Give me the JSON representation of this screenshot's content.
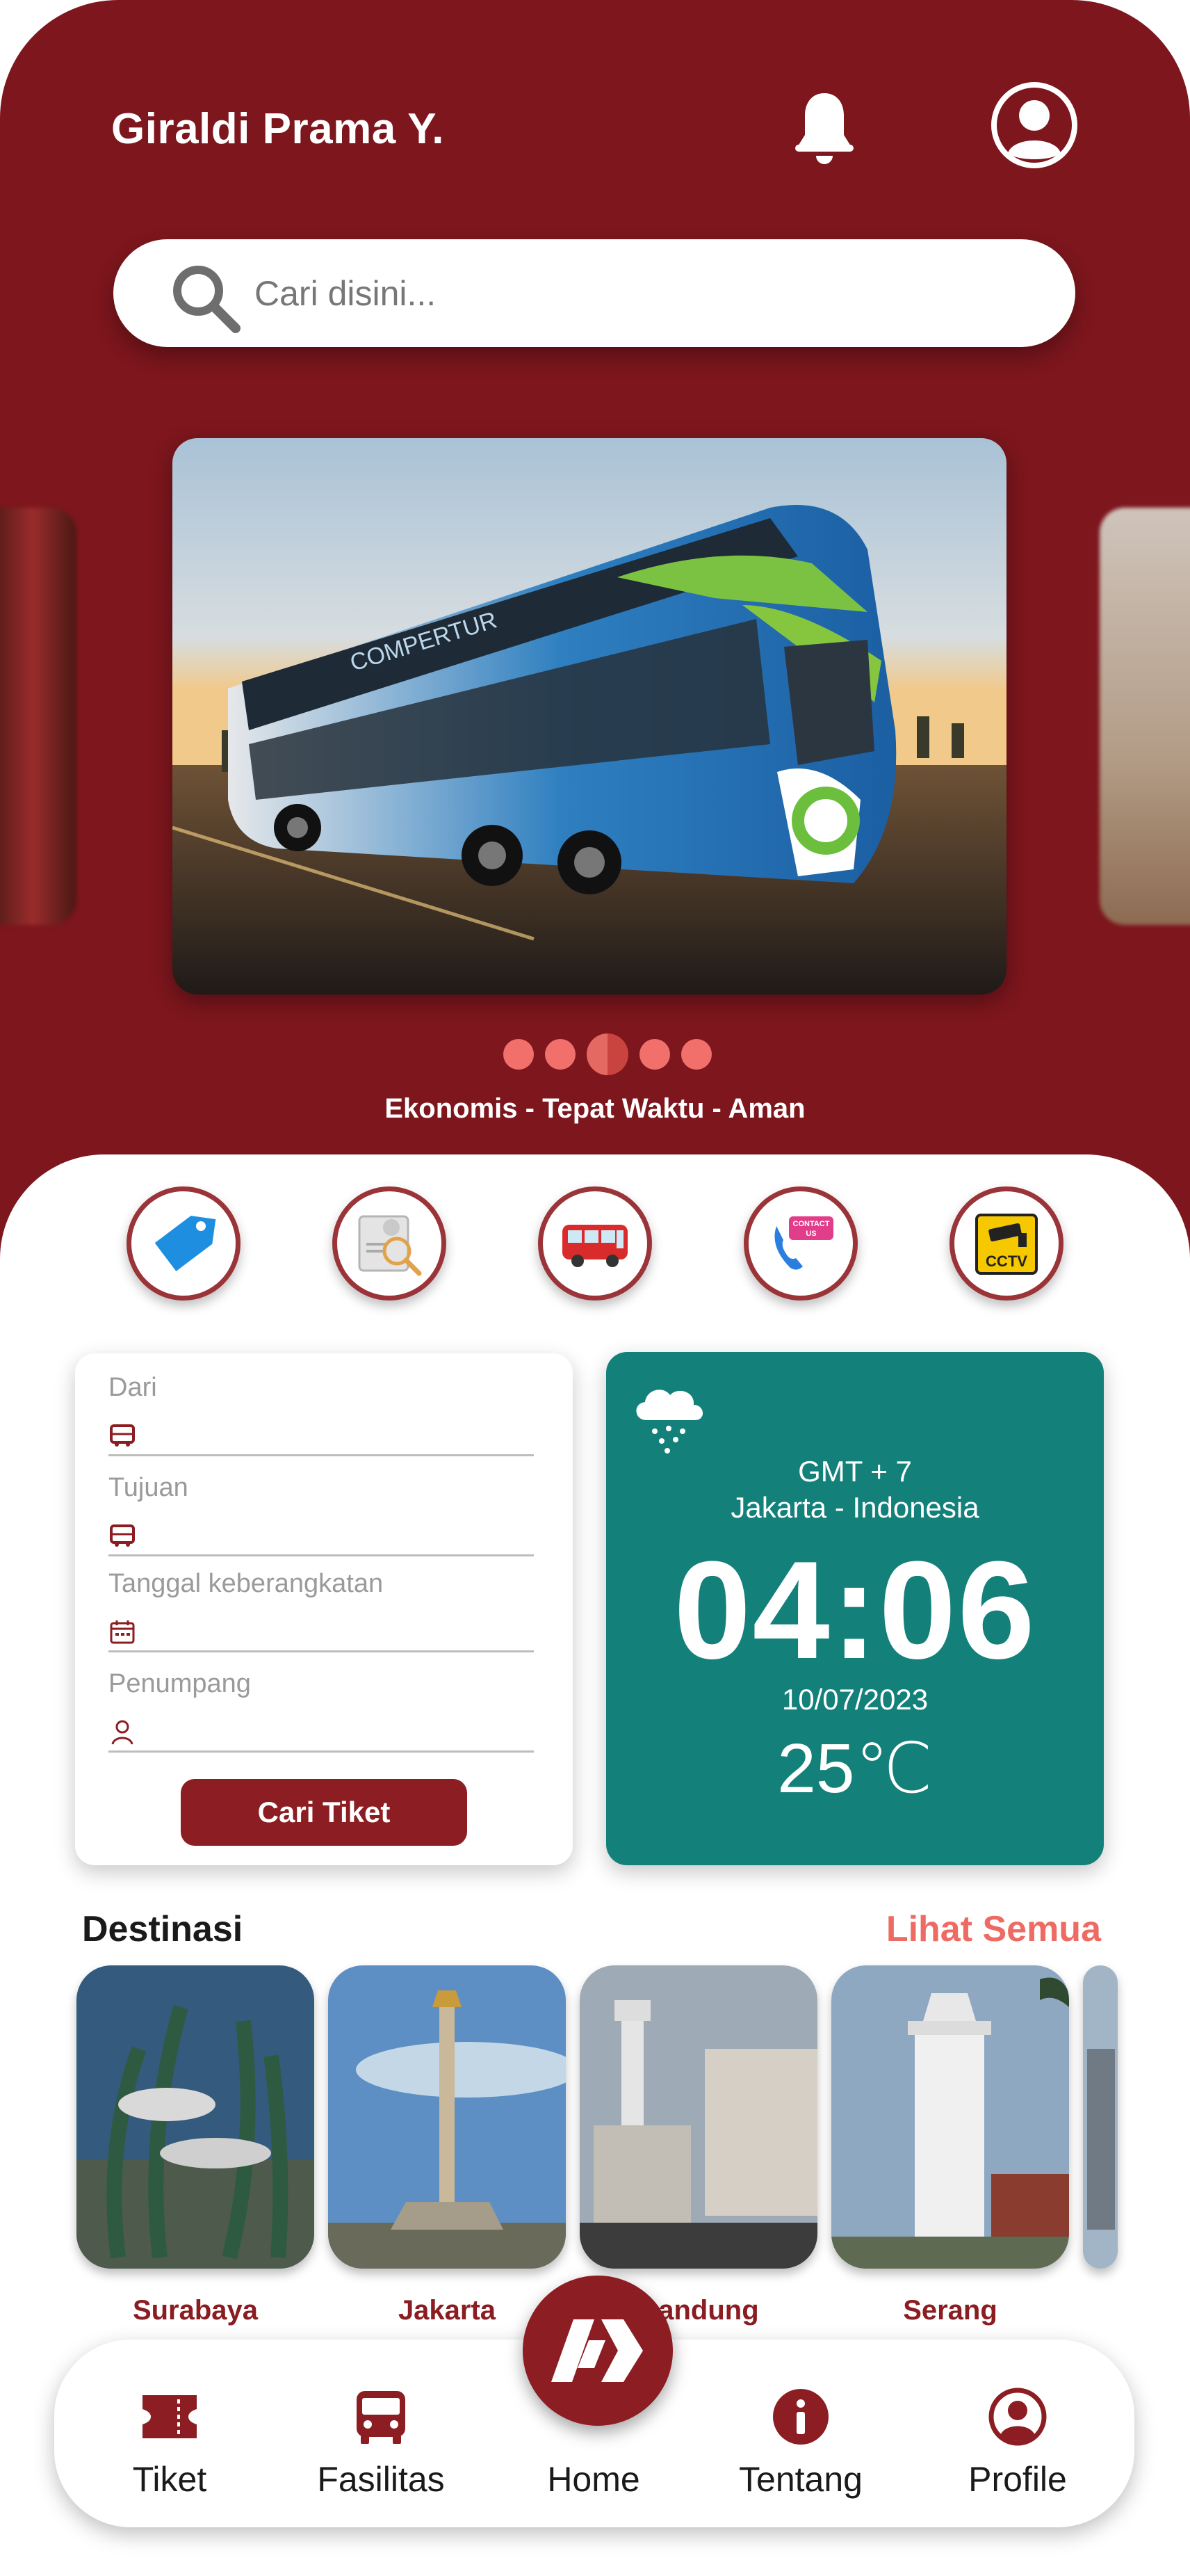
{
  "header": {
    "username": "Giraldi Prama Y.",
    "icons": [
      "bell-icon",
      "user-avatar-icon"
    ]
  },
  "search": {
    "placeholder": "Cari disini..."
  },
  "hero": {
    "carousel_pages": 5,
    "active_page": 3,
    "tagline": "Ekonomis - Tepat Waktu - Aman"
  },
  "quick_actions": [
    {
      "name": "promo",
      "icon": "price-tag-icon"
    },
    {
      "name": "check-ticket",
      "icon": "document-search-icon"
    },
    {
      "name": "bus",
      "icon": "bus-icon"
    },
    {
      "name": "contact-us",
      "icon": "contact-us-icon",
      "text": "CONTACT US"
    },
    {
      "name": "cctv",
      "icon": "cctv-icon",
      "text": "CCTV"
    }
  ],
  "booking_form": {
    "fields": [
      {
        "label": "Dari",
        "icon": "bus-icon"
      },
      {
        "label": "Tujuan",
        "icon": "bus-icon"
      },
      {
        "label": "Tanggal keberangkatan",
        "icon": "calendar-icon"
      },
      {
        "label": "Penumpang",
        "icon": "person-icon"
      }
    ],
    "submit_label": "Cari Tiket"
  },
  "weather": {
    "icon": "snow-cloud-icon",
    "timezone": "GMT + 7",
    "location": "Jakarta - Indonesia",
    "time": "04:06",
    "date": "10/07/2023",
    "temperature": "25℃"
  },
  "destinations": {
    "title": "Destinasi",
    "see_all": "Lihat Semua",
    "items": [
      {
        "label": "Surabaya"
      },
      {
        "label": "Jakarta"
      },
      {
        "label": "Bandung"
      },
      {
        "label": "Serang"
      }
    ]
  },
  "bottom_nav": {
    "items": [
      {
        "label": "Tiket",
        "icon": "ticket-icon"
      },
      {
        "label": "Fasilitas",
        "icon": "bus-icon"
      },
      {
        "label": "Home",
        "icon": "home-logo-icon"
      },
      {
        "label": "Tentang",
        "icon": "info-icon"
      },
      {
        "label": "Profile",
        "icon": "profile-icon"
      }
    ]
  },
  "colors": {
    "primary": "#7d161d",
    "button": "#8c1d22",
    "accent": "#ee6b63",
    "weather_card": "#14807a"
  }
}
